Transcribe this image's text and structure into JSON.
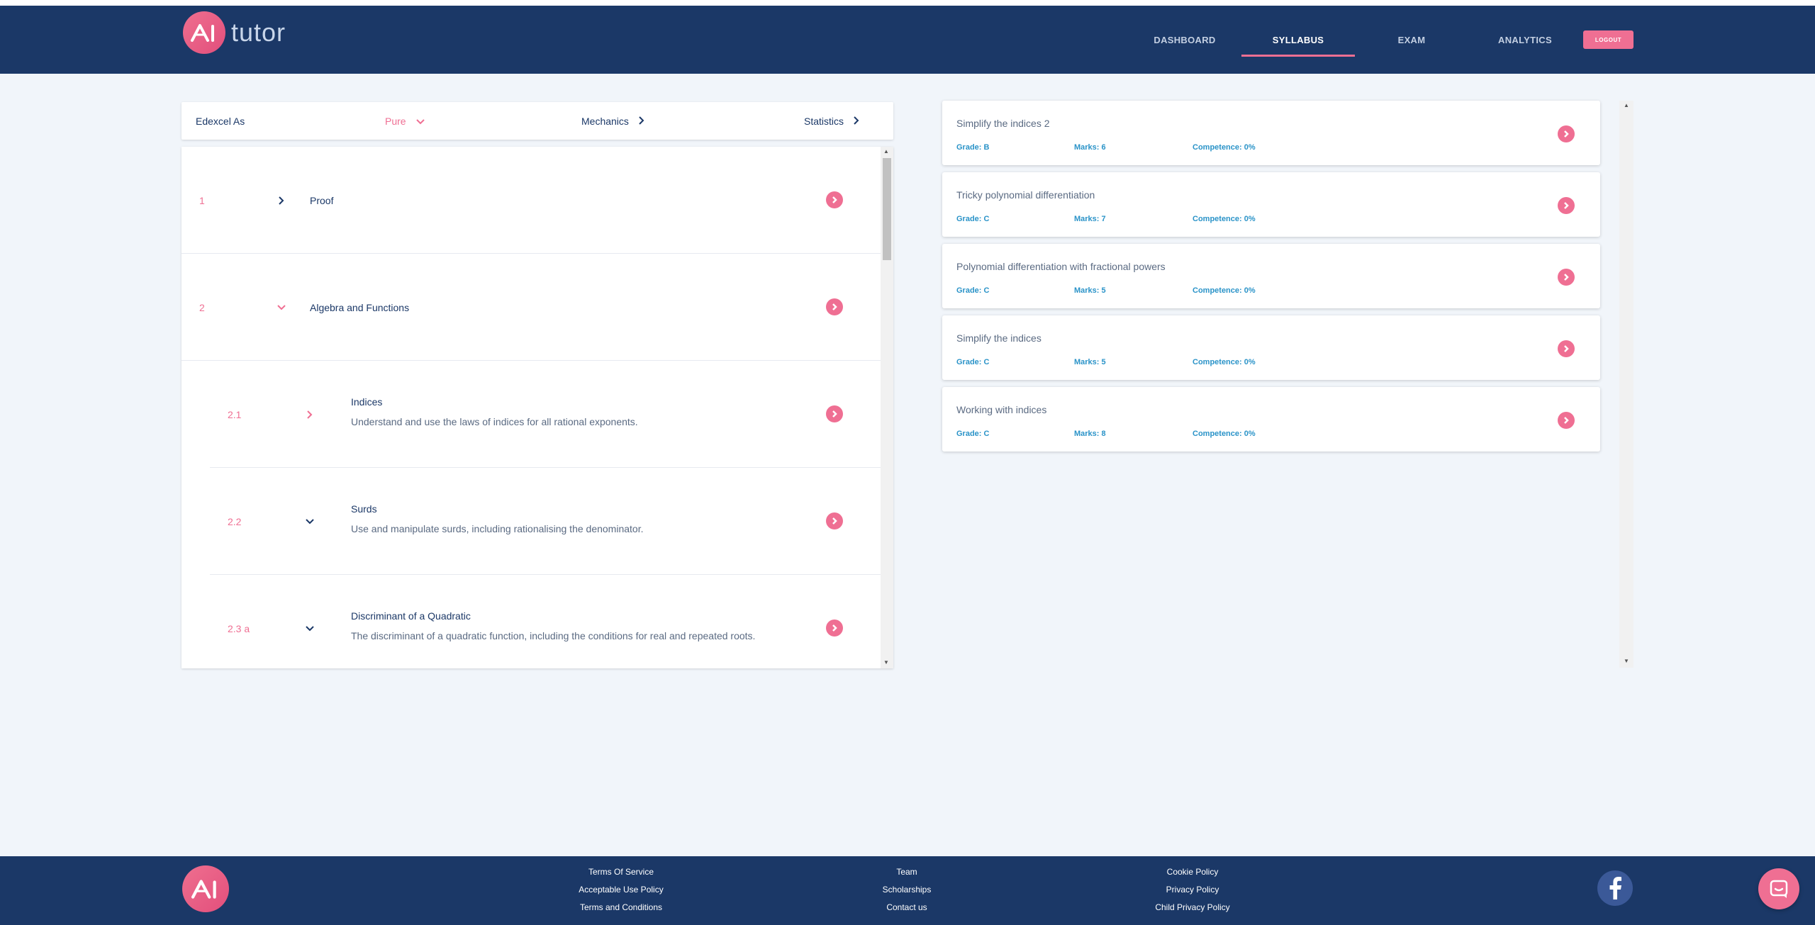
{
  "brand": {
    "name": "tutor",
    "logo_icon": "ai-logo-icon",
    "accent": "#ef6f93",
    "navy": "#1b3867"
  },
  "nav": {
    "items": [
      "DASHBOARD",
      "SYLLABUS",
      "EXAM",
      "ANALYTICS"
    ],
    "active": "SYLLABUS",
    "logout": "LOGOUT"
  },
  "syllabus": {
    "course": "Edexcel As",
    "tabs": [
      {
        "label": "Pure",
        "state": "expanded"
      },
      {
        "label": "Mechanics",
        "state": "collapsed"
      },
      {
        "label": "Statistics",
        "state": "collapsed"
      }
    ],
    "rows": [
      {
        "num": "1",
        "title": "Proof",
        "desc": ""
      },
      {
        "num": "2",
        "title": "Algebra and Functions",
        "desc": ""
      },
      {
        "num": "2.1",
        "title": "Indices",
        "desc": "Understand and use the laws of indices for all rational exponents."
      },
      {
        "num": "2.2",
        "title": "Surds",
        "desc": "Use and manipulate surds, including rationalising the denominator."
      },
      {
        "num": "2.3 a",
        "title": "Discriminant of a Quadratic",
        "desc": "The discriminant of a quadratic function, including the conditions for real and repeated roots."
      }
    ]
  },
  "questions": [
    {
      "title": "Simplify the indices 2",
      "grade": "Grade: B",
      "marks": "Marks: 6",
      "competence": "Competence: 0%"
    },
    {
      "title": "Tricky polynomial differentiation",
      "grade": "Grade: C",
      "marks": "Marks: 7",
      "competence": "Competence: 0%"
    },
    {
      "title": "Polynomial differentiation with fractional powers",
      "grade": "Grade: C",
      "marks": "Marks: 5",
      "competence": "Competence: 0%"
    },
    {
      "title": "Simplify the indices",
      "grade": "Grade: C",
      "marks": "Marks: 5",
      "competence": "Competence: 0%"
    },
    {
      "title": "Working with indices",
      "grade": "Grade: C",
      "marks": "Marks: 8",
      "competence": "Competence: 0%"
    }
  ],
  "footer": {
    "col1": [
      "Terms Of Service",
      "Acceptable Use Policy",
      "Terms and Conditions"
    ],
    "col2": [
      "Team",
      "Scholarships",
      "Contact us"
    ],
    "col3": [
      "Cookie Policy",
      "Privacy Policy",
      "Child Privacy Policy"
    ],
    "social_icon": "facebook-icon",
    "chat_icon": "chat-bubble-icon"
  }
}
